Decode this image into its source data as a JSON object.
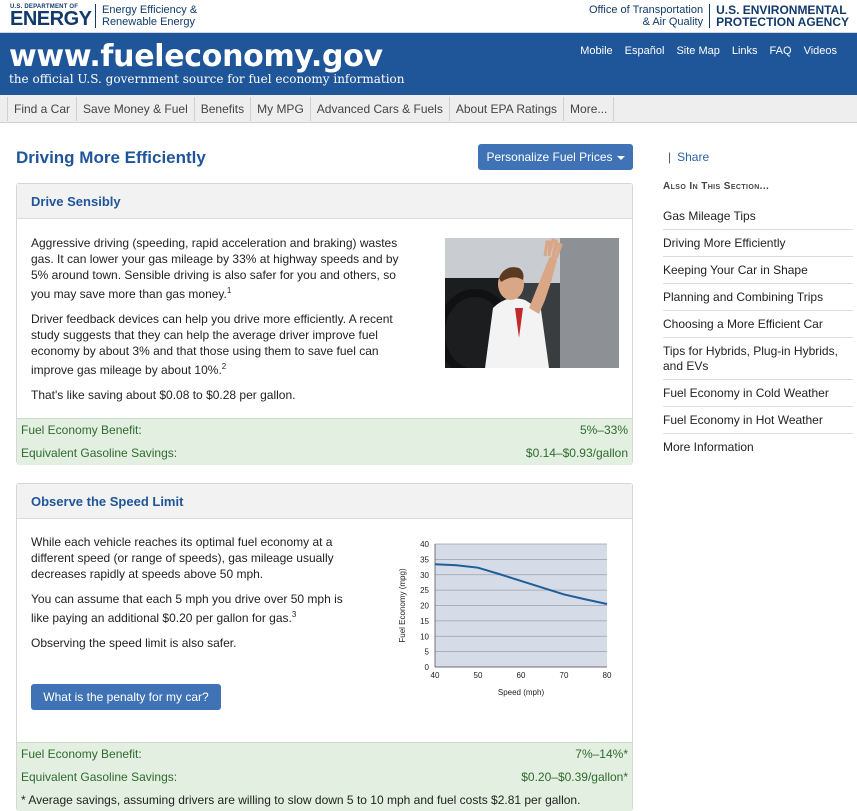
{
  "top": {
    "doe_small": "U.S. DEPARTMENT OF",
    "doe_big": "ENERGY",
    "eere_line1": "Energy Efficiency &",
    "eere_line2": "Renewable Energy",
    "ota_line1": "Office of Transportation",
    "ota_line2": "& Air Quality",
    "epa_line1": "U.S. ENVIRONMENTAL",
    "epa_line2": "PROTECTION AGENCY"
  },
  "header": {
    "title": "www.fueleconomy.gov",
    "subtitle": "the official U.S. government source for fuel economy information",
    "links": [
      "Mobile",
      "Español",
      "Site Map",
      "Links",
      "FAQ",
      "Videos"
    ]
  },
  "nav": {
    "items": [
      "Find a Car",
      "Save Money & Fuel",
      "Benefits",
      "My MPG",
      "Advanced Cars & Fuels",
      "About EPA Ratings",
      "More..."
    ]
  },
  "page": {
    "title": "Driving More Efficiently",
    "fuel_prices_button": "Personalize Fuel Prices"
  },
  "drive_sensibly": {
    "heading": "Drive Sensibly",
    "para1": "Aggressive driving (speeding, rapid acceleration and braking) wastes gas. It can lower your gas mileage by 33% at highway speeds and by 5% around town. Sensible driving is also safer for you and others, so you may save more than gas money.",
    "para1_sup": "1",
    "para2": "Driver feedback devices can help you drive more efficiently. A recent study suggests that they can help the average driver improve fuel economy by about 3% and that those using them to save fuel can improve gas mileage by about 10%.",
    "para2_sup": "2",
    "para3": "That's like saving about $0.08 to $0.28 per gallon.",
    "benefit_label": "Fuel Economy Benefit:",
    "benefit_value": "5%–33%",
    "savings_label": "Equivalent Gasoline Savings:",
    "savings_value": "$0.14–$0.93/gallon"
  },
  "speed_limit": {
    "heading": "Observe the Speed Limit",
    "para1": "While each vehicle reaches its optimal fuel economy at a different speed (or range of speeds), gas mileage usually decreases rapidly at speeds above 50 mph.",
    "para2": "You can assume that each 5 mph you drive over 50 mph is like paying an additional $0.20 per gallon for gas.",
    "para2_sup": "3",
    "para3": "Observing the speed limit is also safer.",
    "penalty_button": "What is the penalty for my car?",
    "benefit_label": "Fuel Economy Benefit:",
    "benefit_value": "7%–14%*",
    "savings_label": "Equivalent Gasoline Savings:",
    "savings_value": "$0.20–$0.39/gallon*",
    "footnote": "* Average savings, assuming drivers are willing to slow down 5 to 10 mph and fuel costs $2.81 per gallon."
  },
  "sidebar": {
    "share_sep": "|",
    "share": "Share",
    "heading": "Also In This Section...",
    "items": [
      "Gas Mileage Tips",
      "Driving More Efficiently",
      "Keeping Your Car in Shape",
      "Planning and Combining Trips",
      "Choosing a More Efficient Car",
      "Tips for Hybrids, Plug-in Hybrids, and EVs",
      "Fuel Economy in Cold Weather",
      "Fuel Economy in Hot Weather",
      "More Information"
    ]
  },
  "chart_data": {
    "type": "line",
    "title": "",
    "xlabel": "Speed (mph)",
    "ylabel": "Fuel Economy (mpg)",
    "xlim": [
      40,
      80
    ],
    "ylim": [
      0,
      40
    ],
    "xticks": [
      40,
      50,
      60,
      70,
      80
    ],
    "yticks": [
      0,
      5,
      10,
      15,
      20,
      25,
      30,
      35,
      40
    ],
    "grid": true,
    "series": [
      {
        "x": [
          40,
          45,
          50,
          55,
          60,
          65,
          70,
          75,
          80
        ],
        "y": [
          33.4,
          33.1,
          32.3,
          30.2,
          28.0,
          25.8,
          23.6,
          22.0,
          20.5
        ]
      }
    ],
    "colors": {
      "line": "#1f5e99",
      "plot_bg": "#d6dbe8",
      "grid": "#9aa0ad"
    }
  }
}
